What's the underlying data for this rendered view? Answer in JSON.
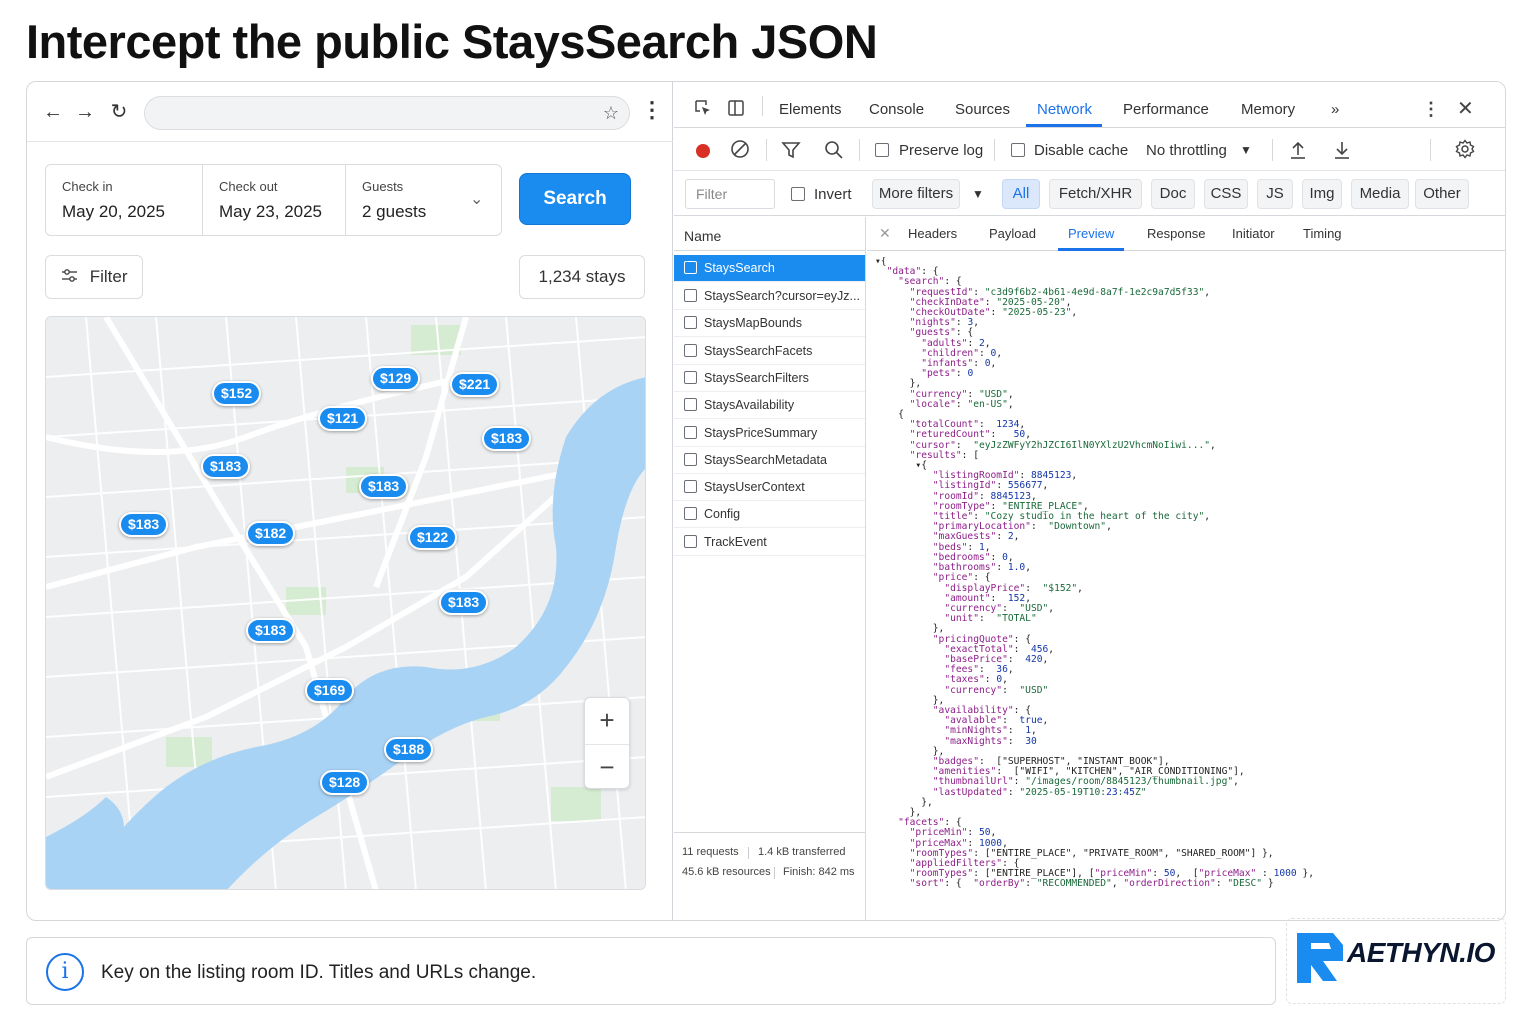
{
  "page": {
    "title": "Intercept the public StaysSearch JSON"
  },
  "browser": {
    "address": {
      "value": ""
    },
    "dates": {
      "checkin_label": "Check in",
      "checkin_value": "May 20, 2025",
      "checkout_label": "Check out",
      "checkout_value": "May 23, 2025",
      "guests_label": "Guests",
      "guests_value": "2 guests"
    },
    "search_label": "Search",
    "filter_label": "Filter",
    "stays_count": "1,234 stays",
    "map": {
      "pins": [
        "$152",
        "$129",
        "$221",
        "$121",
        "$183",
        "$183",
        "$183",
        "$183",
        "$182",
        "$122",
        "$183",
        "$183",
        "$169",
        "$188",
        "$128"
      ],
      "zoom_in": "+",
      "zoom_out": "−"
    }
  },
  "devtools": {
    "tabs": [
      "Elements",
      "Console",
      "Sources",
      "Network",
      "Performance",
      "Memory"
    ],
    "active_tab": "Network",
    "more_tabs": "»",
    "toolbar": {
      "preserve_log": "Preserve log",
      "disable_cache": "Disable cache",
      "throttling": "No throttling"
    },
    "filter": {
      "placeholder": "Filter",
      "invert": "Invert",
      "more_filters": "More filters",
      "types": [
        "All",
        "Fetch/XHR",
        "Doc",
        "CSS",
        "JS",
        "Img",
        "Media",
        "Other"
      ],
      "active_type": "All"
    },
    "requests": {
      "header": "Name",
      "items": [
        "StaysSearch",
        "StaysSearch?cursor=eyJz...",
        "StaysMapBounds",
        "StaysSearchFacets",
        "StaysSearchFilters",
        "StaysAvailability",
        "StaysPriceSummary",
        "StaysSearchMetadata",
        "StaysUserContext",
        "Config",
        "TrackEvent"
      ],
      "selected": "StaysSearch",
      "footer": {
        "requests": "11 requests",
        "transferred": "1.4 kB transferred",
        "resources": "45.6 kB resources",
        "finish": "Finish: 842 ms"
      }
    },
    "detail": {
      "tabs": [
        "Headers",
        "Payload",
        "Preview",
        "Response",
        "Initiator",
        "Timing"
      ],
      "active": "Preview"
    },
    "json_lines": [
      "▾{",
      "  \"data\": {",
      "    \"search\": {",
      "      \"requestId\": \"c3d9f6b2-4b61-4e9d-8a7f-1e2c9a7d5f33\",",
      "      \"checkInDate\": \"2025-05-20\",",
      "      \"checkOutDate\": \"2025-05-23\",",
      "      \"nights\": 3,",
      "      \"guests\": {",
      "        \"adults\": 2,",
      "        \"children\": 0,",
      "        \"infants\": 0,",
      "        \"pets\": 0",
      "      },",
      "      \"currency\": \"USD\",",
      "      \"locale\": \"en-US\",",
      "    {",
      "      \"totalCount\":  1234,",
      "      \"returedCount\":   50,",
      "      \"cursor\":  \"eyJzZWFyY2hJZCI6IlN0YXlzU2VhcmNoIiwi...\",",
      "      \"results\": [",
      "       ▾{",
      "          \"listingRoomId\": 8845123,",
      "          \"listingId\": 556677,",
      "          \"roomId\": 8845123,",
      "          \"roomType\": \"ENTIRE_PLACE\",",
      "          \"title\": \"Cozy studio in the heart of the city\",",
      "          \"primaryLocation\":  \"Downtown\",",
      "          \"maxGuests\": 2,",
      "          \"beds\": 1,",
      "          \"bedrooms\": 0,",
      "          \"bathrooms\": 1.0,",
      "          \"price\": {",
      "            \"displayPrice\":  \"$152\",",
      "            \"amount\":  152,",
      "            \"currency\":  \"USD\",",
      "            \"unit\":  \"TOTAL\"",
      "          },",
      "          \"pricingQuote\": {",
      "            \"exactTotal\":  456,",
      "            \"basePrice\":  420,",
      "            \"fees\":  36,",
      "            \"taxes\": 0,",
      "            \"currency\":  \"USD\"",
      "          },",
      "          \"availability\": {",
      "            \"avalable\":  true,",
      "            \"minNights\":  1,",
      "            \"maxNights\":  30",
      "          },",
      "          \"badges\":  [\"SUPERHOST\", \"INSTANT_BOOK\"],",
      "          \"amenities\":  [\"WIFI\", \"KITCHEN\", \"AIR_CONDITIONING\"],",
      "          \"thumbnailUrl\": \"/images/room/8845123/thumbnail.jpg\",",
      "          \"lastUpdated\": \"2025-05-19T10:23:45Z\"",
      "        },",
      "      },",
      "    \"facets\": {",
      "      \"priceMin\": 50,",
      "      \"priceMax\": 1000,",
      "      \"roomTypes\": [\"ENTIRE_PLACE\", \"PRIVATE_ROOM\", \"SHARED_ROOM\"] },",
      "      \"appliedFilters\": {",
      "      \"roomTypes\": [\"ENTIRE_PLACE\"], [\"priceMin\": 50,  [\"priceMax\" : 1000 },",
      "      \"sort\": {  \"orderBy\": \"RECOMMENDED\", \"orderDirection\": \"DESC\" }"
    ]
  },
  "tip": {
    "text": "Key on the listing room ID. Titles and URLs change."
  },
  "logo": {
    "text": "AETHYN.IO"
  },
  "colors": {
    "accent": "#1a8cf0",
    "devtools_blue": "#1a73e8",
    "record_red": "#d93025"
  }
}
